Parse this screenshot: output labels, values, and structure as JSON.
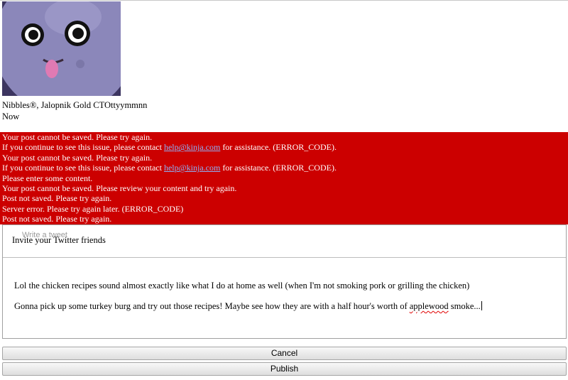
{
  "post": {
    "author": "Nibbles®, Jalopnik Gold CTOttyymmnn",
    "timestamp": "Now"
  },
  "errors": [
    {
      "text": "Your post cannot be saved. Please try again."
    },
    {
      "before": "If you continue to see this issue, please contact ",
      "link": "help@kinja.com",
      "after": " for assistance. (ERROR_CODE)."
    },
    {
      "text": "Your post cannot be saved. Please try again."
    },
    {
      "before": "If you continue to see this issue, please contact ",
      "link": "help@kinja.com",
      "after": " for assistance. (ERROR_CODE)."
    },
    {
      "text": "Please enter some content."
    },
    {
      "text": "Your post cannot be saved. Please review your content and try again."
    },
    {
      "text": "Post not saved. Please try again."
    },
    {
      "text": "Server error. Please try again later. (ERROR_CODE)"
    },
    {
      "text": "Post not saved. Please try again."
    }
  ],
  "editor": {
    "tweet_placeholder": "Write a tweet",
    "invite_label": "Invite your Twitter friends",
    "paragraph1": "Lol the chicken recipes sound almost exactly like what I do at home as well (when I'm not smoking pork or grilling the chicken)",
    "paragraph2_before": "Gonna pick up some turkey burg and try out those recipes!  Maybe see how they are with a half hour's worth of ",
    "paragraph2_misspelled": "applewood",
    "paragraph2_after": " smoke..."
  },
  "actions": {
    "cancel_label": "Cancel",
    "publish_label": "Publish"
  },
  "colors": {
    "error_background": "#cc0000",
    "link": "#8fb0f5"
  }
}
